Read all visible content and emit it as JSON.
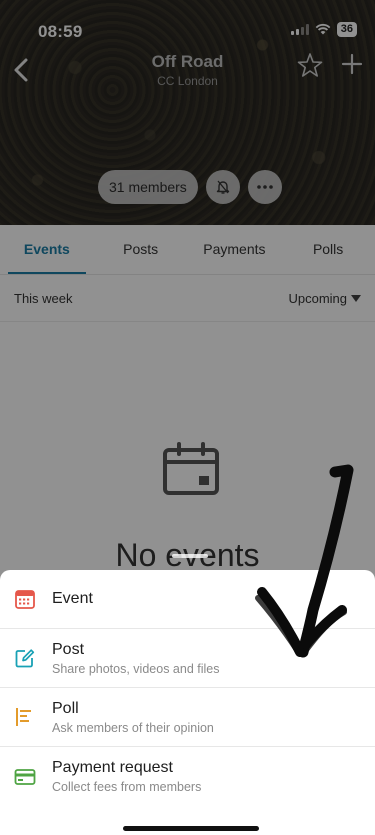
{
  "status_bar": {
    "time": "08:59",
    "battery": "36",
    "wifi_icon": "wifi-icon",
    "signal_icon": "signal-icon"
  },
  "header": {
    "back_icon": "chevron-left-icon",
    "group_name": "Off Road",
    "group_subtitle": "CC London",
    "star_icon": "star-icon",
    "add_icon": "plus-icon",
    "members_label": "31 members",
    "notify_icon": "bell-icon",
    "more_icon": "more-icon"
  },
  "tabs": [
    {
      "label": "Events",
      "active": true
    },
    {
      "label": "Posts",
      "active": false
    },
    {
      "label": "Payments",
      "active": false
    },
    {
      "label": "Polls",
      "active": false
    }
  ],
  "filter": {
    "period": "This week",
    "sort": "Upcoming"
  },
  "empty_state": {
    "icon": "calendar-icon",
    "text": "No events"
  },
  "sheet": {
    "items": [
      {
        "title": "Event",
        "subtitle": "",
        "icon": "calendar-icon",
        "color": "#e5574a"
      },
      {
        "title": "Post",
        "subtitle": "Share photos, videos and files",
        "icon": "edit-icon",
        "color": "#19a1b5"
      },
      {
        "title": "Poll",
        "subtitle": "Ask members of their opinion",
        "icon": "poll-icon",
        "color": "#e39b2b"
      },
      {
        "title": "Payment request",
        "subtitle": "Collect fees from members",
        "icon": "card-icon",
        "color": "#4fa443"
      }
    ]
  },
  "colors": {
    "accent": "#1b7ea6"
  }
}
